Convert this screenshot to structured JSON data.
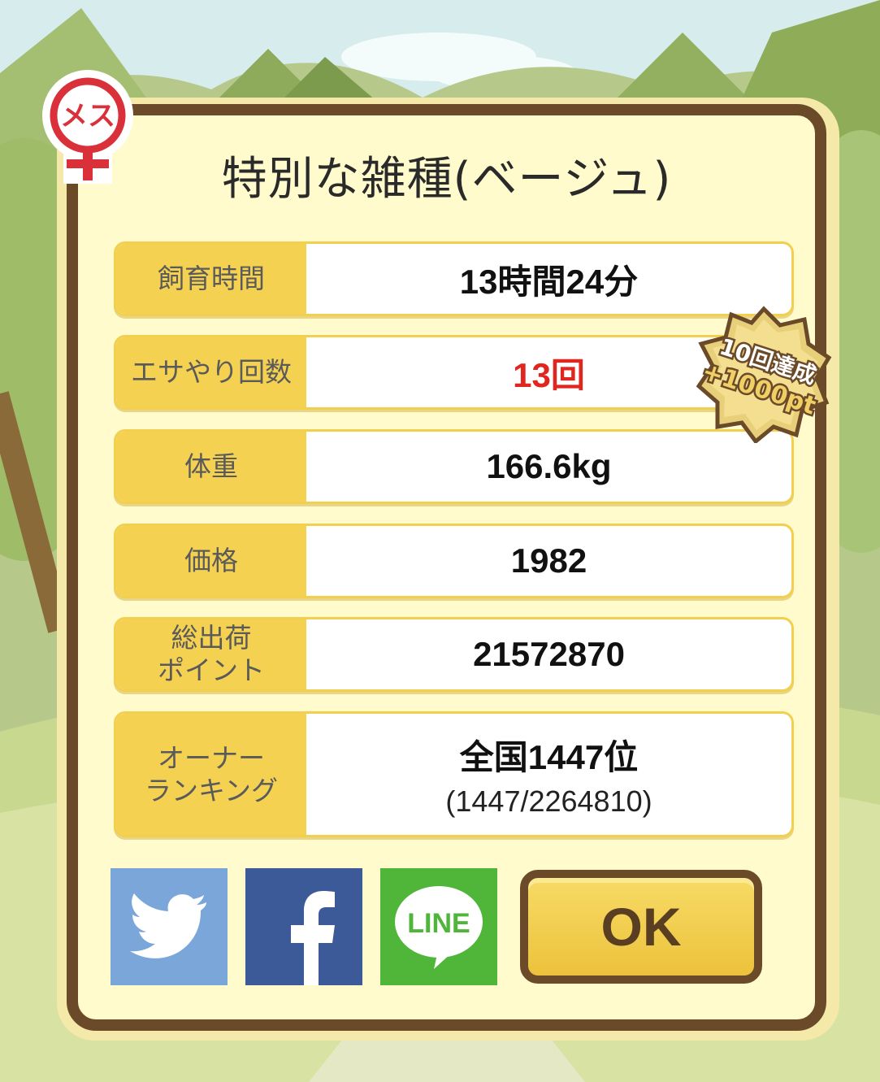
{
  "title": "特別な雑種(ベージュ)",
  "gender_badge": {
    "label": "メス",
    "icon": "female-symbol-icon",
    "color": "#d9303a"
  },
  "stats": [
    {
      "label": "飼育時間",
      "value": "13時間24分"
    },
    {
      "label": "エサやり回数",
      "value": "13回",
      "value_color": "#e0261e"
    },
    {
      "label": "体重",
      "value": "166.6kg"
    },
    {
      "label": "価格",
      "value": "1982"
    },
    {
      "label_line1": "総出荷",
      "label_line2": "ポイント",
      "value": "21572870"
    },
    {
      "label_line1": "オーナー",
      "label_line2": "ランキング",
      "value": "全国1447位",
      "sub": "(1447/2264810)"
    }
  ],
  "achievement_badge": {
    "line1": "10回達成",
    "line2": "+1000pt"
  },
  "share": [
    {
      "name": "twitter",
      "icon": "twitter-bird-icon",
      "color": "#7ba6d9"
    },
    {
      "name": "facebook",
      "icon": "facebook-f-icon",
      "color": "#3c5998"
    },
    {
      "name": "line",
      "label": "LINE",
      "icon": "line-logo-icon",
      "color": "#4fb63a"
    }
  ],
  "ok_button": {
    "label": "OK"
  }
}
